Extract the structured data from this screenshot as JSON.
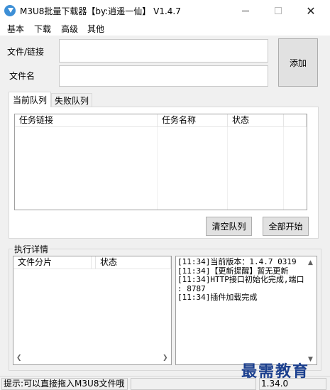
{
  "window": {
    "title": "M3U8批量下载器【by:逍遥一仙】 V1.4.7",
    "minimize_icon": "minimize-icon",
    "maximize_icon": "maximize-icon",
    "close_glyph": "✕"
  },
  "menu": {
    "items": [
      "基本",
      "下载",
      "高级",
      "其他"
    ]
  },
  "form": {
    "file_link_label": "文件/链接",
    "file_link_value": "",
    "file_name_label": "文件名",
    "file_name_value": "",
    "add_button": "添加"
  },
  "tabs": [
    {
      "label": "当前队列",
      "selected": true
    },
    {
      "label": "失败队列",
      "selected": false
    }
  ],
  "queue_table": {
    "columns": [
      "任务链接",
      "任务名称",
      "状态"
    ],
    "rows": []
  },
  "queue_buttons": {
    "clear": "清空队列",
    "start_all": "全部开始"
  },
  "details": {
    "title": "执行详情",
    "parts_columns": [
      "文件分片",
      "状态"
    ],
    "log_lines": [
      "[11:34]当前版本：1.4.7 0319",
      "[11:34]【更新提醒】暂无更新",
      "[11:34]HTTP接口初始化完成,端口",
      ": 8787",
      "[11:34]插件加载完成"
    ]
  },
  "status_bar": {
    "hint": "提示:可以直接拖入M3U8文件哦",
    "middle": "",
    "version": "1.34.0"
  },
  "watermark": "最需教育"
}
